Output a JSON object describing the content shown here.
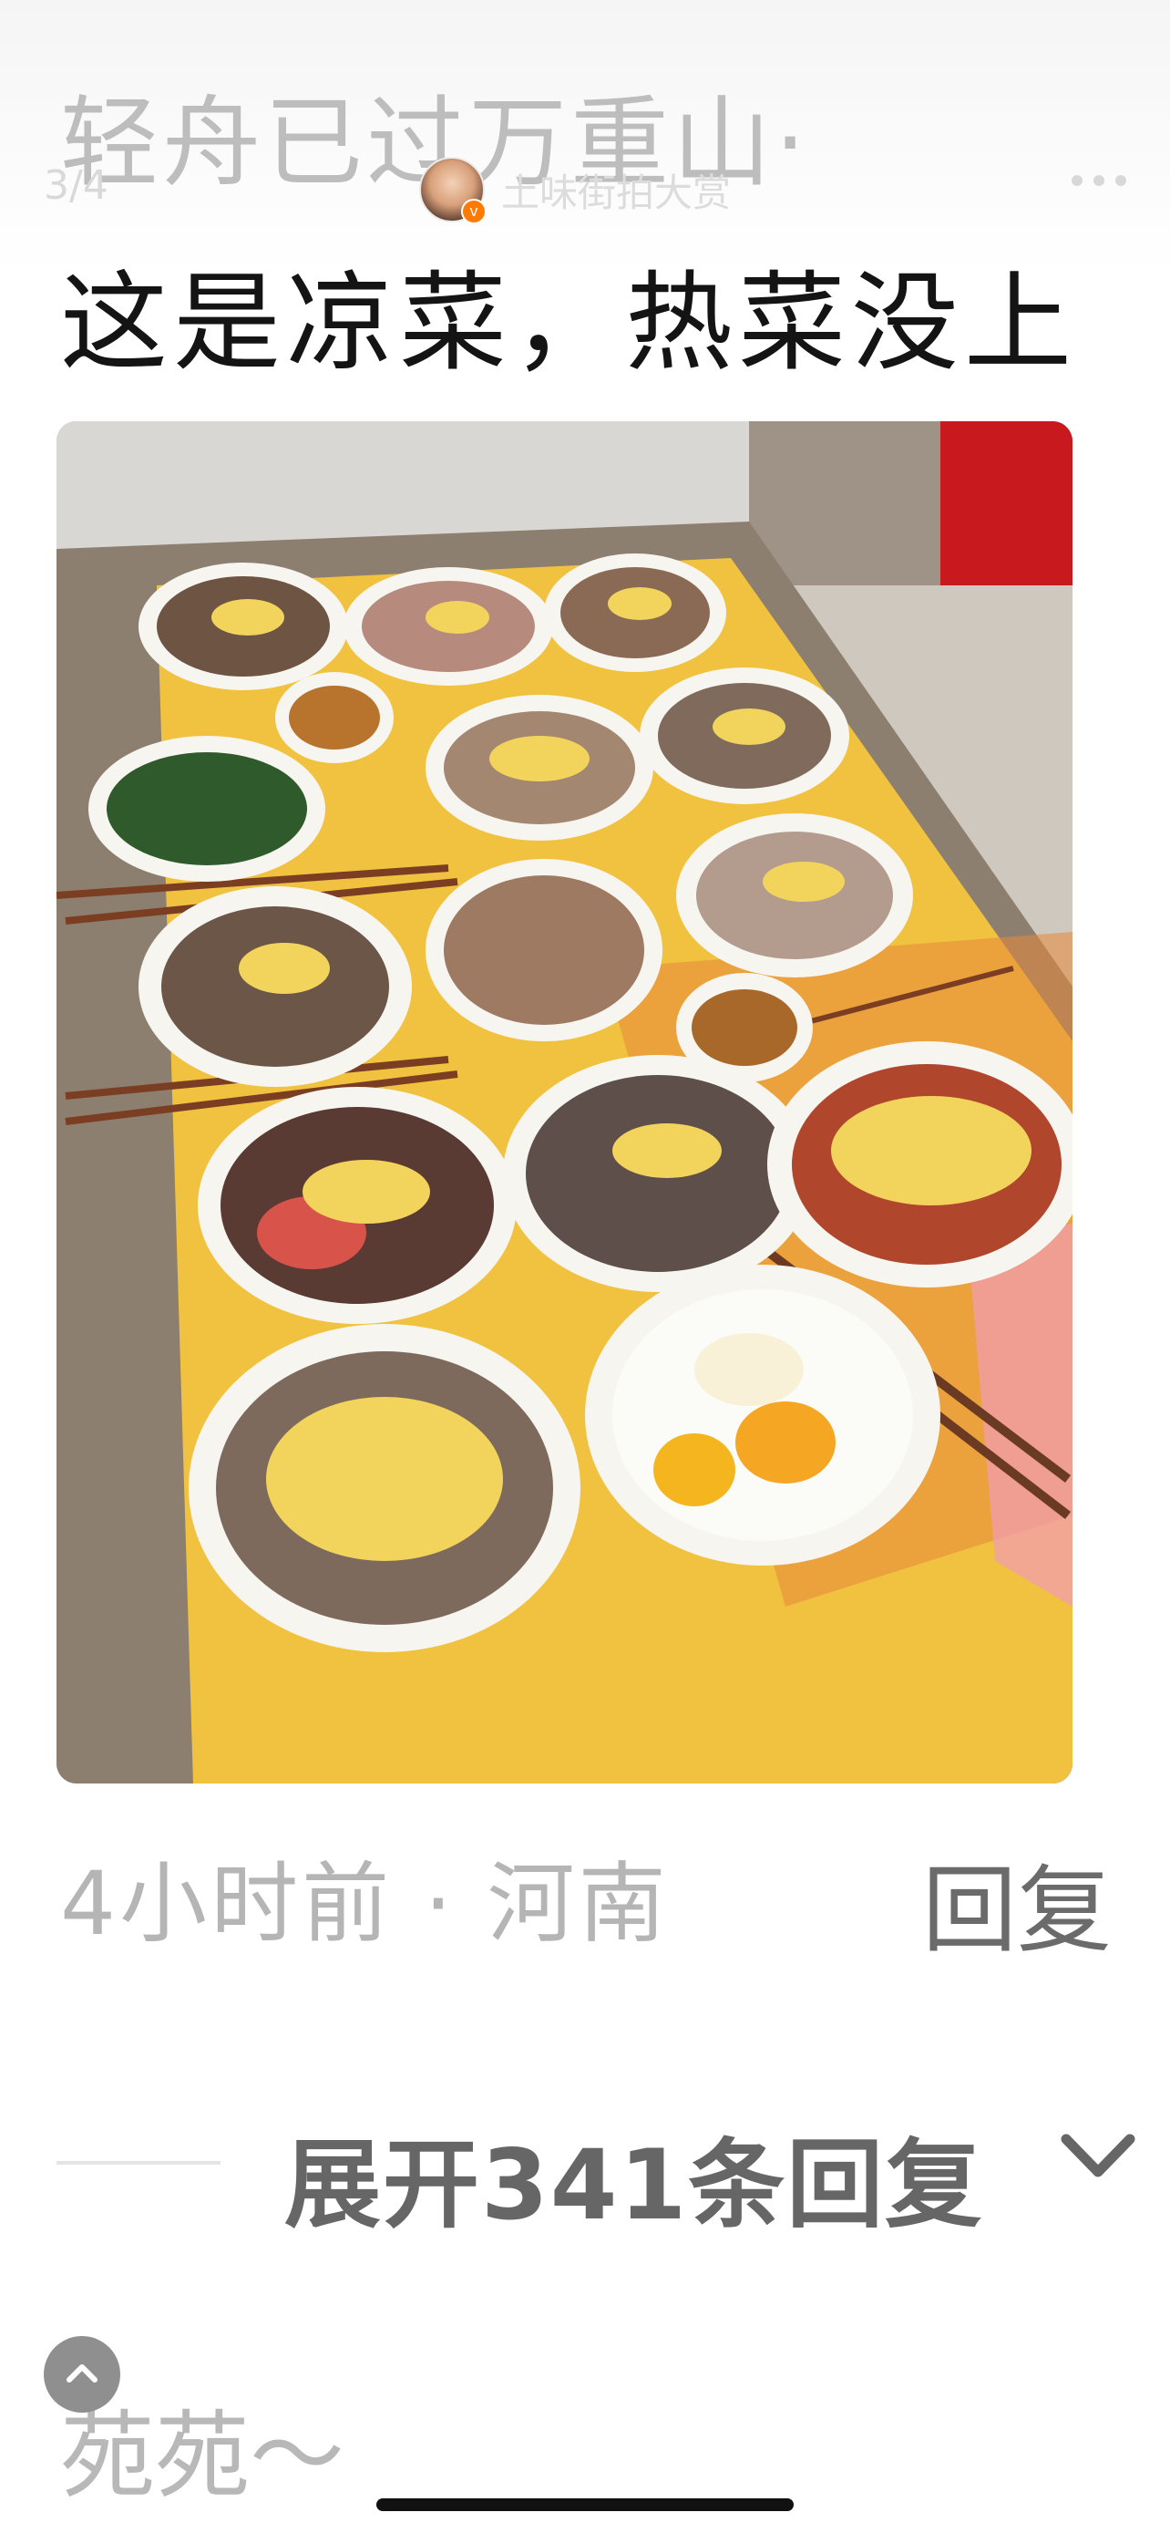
{
  "comment": {
    "author_line": "轻舟已过万重山·",
    "text": "这是凉菜，热菜没上",
    "meta": "4小时前 · 河南",
    "reply_label": "回复",
    "expand_label": "展开341条回复"
  },
  "topbar": {
    "page_counter": "3/4",
    "channel_name": "土味街拍大赏",
    "verified_mark": "v"
  },
  "next_comment": {
    "author": "苑苑～"
  },
  "icons": {
    "more": "more-dots-icon",
    "verified": "verified-badge-icon",
    "expand": "chevron-down-icon",
    "scroll_top": "chevron-up-icon"
  },
  "colors": {
    "tablecloth_yellow": "#f1c23f",
    "tablecloth_orange": "#e8883a",
    "plate_white": "#f7f5f0",
    "ginger_yellow": "#f2d45c",
    "meat_brown": "#8b6a55",
    "cucumber_green": "#2f5a2c"
  }
}
